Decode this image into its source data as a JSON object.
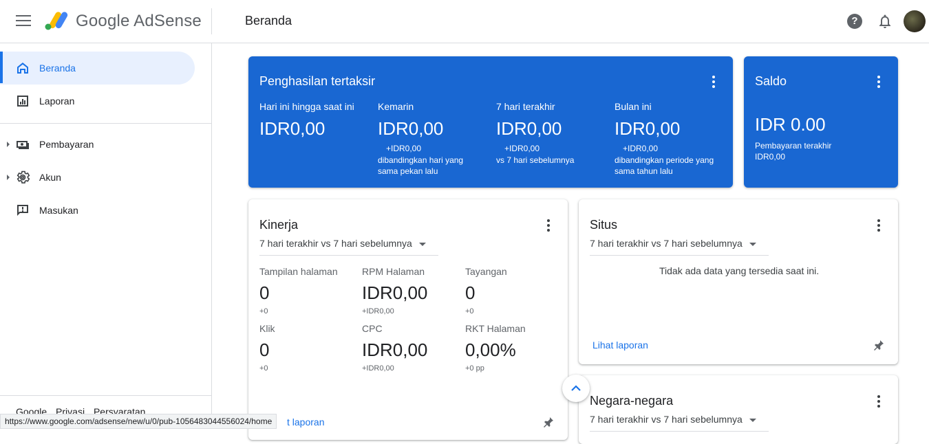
{
  "header": {
    "brand": "Google AdSense",
    "page_title": "Beranda",
    "icons": [
      "menu-icon",
      "adsense-logo",
      "help-icon",
      "notification-bell-icon",
      "avatar"
    ]
  },
  "sidebar": {
    "items": [
      {
        "label": "Beranda",
        "icon": "home-icon",
        "active": true
      },
      {
        "label": "Laporan",
        "icon": "bar-chart-icon"
      },
      {
        "label": "Pembayaran",
        "icon": "payments-icon",
        "expandable": true
      },
      {
        "label": "Akun",
        "icon": "gear-icon",
        "expandable": true
      },
      {
        "label": "Masukan",
        "icon": "feedback-icon"
      }
    ],
    "footer": [
      "Google",
      "Privasi",
      "Persyaratan"
    ]
  },
  "earnings": {
    "title": "Penghasilan tertaksir",
    "cols": [
      {
        "label": "Hari ini hingga saat ini",
        "value": "IDR0,00"
      },
      {
        "label": "Kemarin",
        "value": "IDR0,00",
        "delta": "+IDR0,00",
        "note": "dibandingkan hari yang sama pekan lalu"
      },
      {
        "label": "7 hari terakhir",
        "value": "IDR0,00",
        "delta": "+IDR0,00",
        "note": "vs 7 hari sebelumnya"
      },
      {
        "label": "Bulan ini",
        "value": "IDR0,00",
        "delta": "+IDR0,00",
        "note": "dibandingkan periode yang sama tahun lalu"
      }
    ]
  },
  "balance": {
    "title": "Saldo",
    "value": "IDR 0.00",
    "note_line1": "Pembayaran terakhir",
    "note_line2": "IDR0,00"
  },
  "performance": {
    "title": "Kinerja",
    "period": "7 hari terakhir vs 7 hari sebelumnya",
    "metrics": [
      {
        "label": "Tampilan halaman",
        "value": "0",
        "delta": "+0"
      },
      {
        "label": "RPM Halaman",
        "value": "IDR0,00",
        "delta": "+IDR0,00"
      },
      {
        "label": "Tayangan",
        "value": "0",
        "delta": "+0"
      },
      {
        "label": "Klik",
        "value": "0",
        "delta": "+0"
      },
      {
        "label": "CPC",
        "value": "IDR0,00",
        "delta": "+IDR0,00"
      },
      {
        "label": "RKT Halaman",
        "value": "0,00%",
        "delta": "+0 pp"
      }
    ],
    "link": "t laporan"
  },
  "sites": {
    "title": "Situs",
    "period": "7 hari terakhir vs 7 hari sebelumnya",
    "empty": "Tidak ada data yang tersedia saat ini.",
    "link": "Lihat laporan"
  },
  "countries": {
    "title": "Negara-negara",
    "period": "7 hari terakhir vs 7 hari sebelumnya"
  },
  "status_url": "https://www.google.com/adsense/new/u/0/pub-1056483044556024/home"
}
